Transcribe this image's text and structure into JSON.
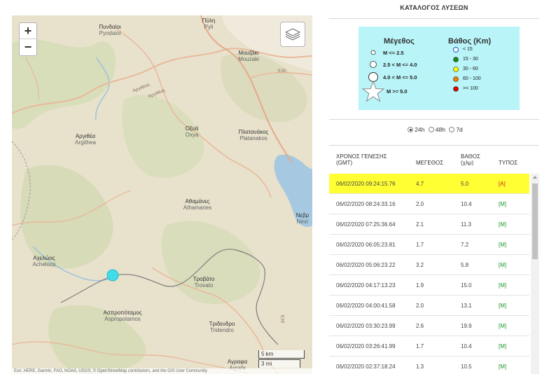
{
  "map": {
    "zoom_in": "+",
    "zoom_out": "−",
    "layers_icon": "layers-icon",
    "places": [
      {
        "name": "Πυνδαίοι",
        "latin": "Pyndaioi"
      },
      {
        "name": "Πύλη",
        "latin": "Pyli"
      },
      {
        "name": "Μουζάκι",
        "latin": "Mouzaki"
      },
      {
        "name": "Αργιθέα",
        "latin": "Argithea"
      },
      {
        "name": "Οξυά",
        "latin": "Oxya"
      },
      {
        "name": "Πλατανάκος",
        "latin": "Platanakos"
      },
      {
        "name": "Αθαμάνες",
        "latin": "Athamanes"
      },
      {
        "name": "Νεβρ",
        "latin": "Nevr"
      },
      {
        "name": "Αχελώος",
        "latin": "Acheloos"
      },
      {
        "name": "Τροβάτο",
        "latin": "Trovato"
      },
      {
        "name": "Ασπροπόταμος",
        "latin": "Aspropotamos"
      },
      {
        "name": "Τριδενδρο",
        "latin": "Tridendro"
      },
      {
        "name": "Αγραφα",
        "latin": "Agrafa"
      }
    ],
    "road_labels": [
      "Αργιθέας",
      "Αργιθέας",
      "Ε30",
      "Ε30"
    ],
    "scale_km": "5 km",
    "scale_mi": "3 mi",
    "attribution": "Esri, HERE, Garmin, FAO, NOAA, USGS, © OpenStreetMap contributors, and the GIS User Community"
  },
  "panel": {
    "title": "ΚΑΤΑΛΟΓΟΣ ΛΥΣΕΩΝ",
    "legend": {
      "magnitude_title": "Μέγεθος",
      "depth_title": "Βάθος (Km)",
      "magnitudes": [
        "M <= 2.5",
        "2.5 < M <= 4.0",
        "4.0 < M <= 5.0",
        "M >= 5.0"
      ],
      "depths": [
        {
          "label": "< 15",
          "color": "#ffffff"
        },
        {
          "label": "15 - 30",
          "color": "#1a8a1a"
        },
        {
          "label": "30 - 60",
          "color": "#ffff00"
        },
        {
          "label": "60 - 100",
          "color": "#f08000"
        },
        {
          "label": ">= 100",
          "color": "#e00000"
        }
      ]
    },
    "range": {
      "options": [
        "24h",
        "48h",
        "7d"
      ],
      "selected": "24h"
    },
    "table": {
      "headers": {
        "time_line1": "ΧΡΟΝΟΣ ΓΕΝΕΣΗΣ",
        "time_line2": "(GMT)",
        "magnitude": "ΜΕΓΕΘΟΣ",
        "depth_line1": "ΒΑΘΟΣ",
        "depth_line2": "(χλμ)",
        "type": "ΤΥΠΟΣ"
      },
      "rows": [
        {
          "time": "06/02/2020 09:24:15.76",
          "magnitude": "4.7",
          "depth": "5.0",
          "type": "[A]"
        },
        {
          "time": "06/02/2020 08:24:33.16",
          "magnitude": "2.0",
          "depth": "10.4",
          "type": "[M]"
        },
        {
          "time": "06/02/2020 07:25:36.64",
          "magnitude": "2.1",
          "depth": "11.3",
          "type": "[M]"
        },
        {
          "time": "06/02/2020 06:05:23.81",
          "magnitude": "1.7",
          "depth": "7.2",
          "type": "[M]"
        },
        {
          "time": "06/02/2020 05:06:23.22",
          "magnitude": "3.2",
          "depth": "5.8",
          "type": "[M]"
        },
        {
          "time": "06/02/2020 04:17:13.23",
          "magnitude": "1.9",
          "depth": "15.0",
          "type": "[M]"
        },
        {
          "time": "06/02/2020 04:00:41.58",
          "magnitude": "2.0",
          "depth": "13.1",
          "type": "[M]"
        },
        {
          "time": "06/02/2020 03:30:23.99",
          "magnitude": "2.6",
          "depth": "19.9",
          "type": "[M]"
        },
        {
          "time": "06/02/2020 03:26:41.99",
          "magnitude": "1.7",
          "depth": "10.4",
          "type": "[M]"
        },
        {
          "time": "06/02/2020 02:37:18.24",
          "magnitude": "1.3",
          "depth": "10.5",
          "type": "[M]"
        }
      ],
      "highlight_color": "#ffff33"
    }
  }
}
